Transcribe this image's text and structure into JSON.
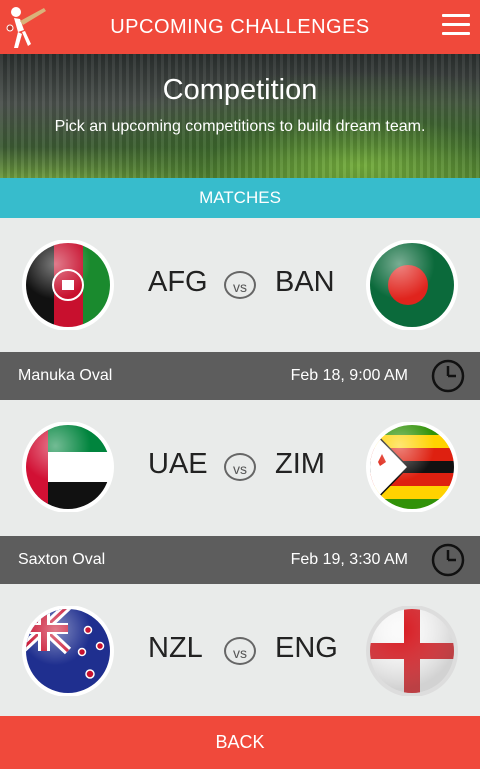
{
  "header": {
    "title": "UPCOMING CHALLENGES"
  },
  "banner": {
    "heading": "Competition",
    "subtitle": "Pick an upcoming competitions to build dream team."
  },
  "section": {
    "title": "MATCHES"
  },
  "matches": [
    {
      "team1": "AFG",
      "team2": "BAN",
      "vs": "vs",
      "venue": "Manuka Oval",
      "time": "Feb 18, 9:00 AM"
    },
    {
      "team1": "UAE",
      "team2": "ZIM",
      "vs": "vs",
      "venue": "Saxton Oval",
      "time": "Feb 19, 3:30 AM"
    },
    {
      "team1": "NZL",
      "team2": "ENG",
      "vs": "vs"
    }
  ],
  "footer": {
    "back_label": "BACK"
  },
  "colors": {
    "accent": "#f0493b",
    "section": "#37bccc",
    "info_bar": "#5d5d5d"
  }
}
